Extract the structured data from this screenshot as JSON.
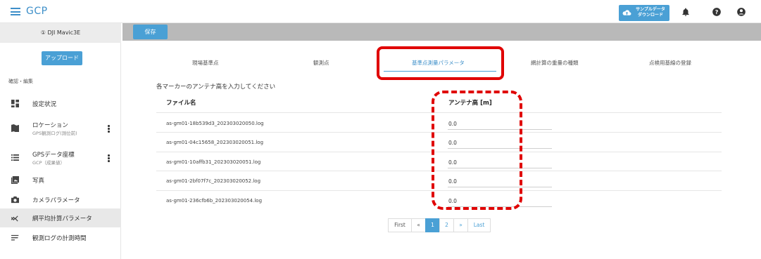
{
  "app": {
    "title": "GCP"
  },
  "header": {
    "sample_button_label_line1": "サンプルデータ",
    "sample_button_label_line2": "ダウンロード"
  },
  "sidebar": {
    "device": "① DJI Mavic3E",
    "upload_label": "アップロード",
    "section_label": "確認・編集",
    "items": [
      {
        "label": "設定状況",
        "sub": ""
      },
      {
        "label": "ロケーション",
        "sub": "GPS観測ログ(測位前)"
      },
      {
        "label": "GPSデータ座標",
        "sub": "GCP（成果値）"
      },
      {
        "label": "写真",
        "sub": ""
      },
      {
        "label": "カメラパラメータ",
        "sub": ""
      },
      {
        "label": "網平均計算パラメータ",
        "sub": ""
      },
      {
        "label": "観測ログの計測時間",
        "sub": ""
      }
    ]
  },
  "toolbar": {
    "save_label": "保存"
  },
  "tabs": [
    "現場基準点",
    "観測点",
    "基準点測量パラメータ",
    "網計算の重量の種類",
    "点検用基線の登録"
  ],
  "main": {
    "instruction": "各マーカーのアンテナ高を入力してください",
    "columns": [
      "ファイル名",
      "アンテナ高 [m]"
    ],
    "rows": [
      {
        "file": "as-gm01-18b539d3_202303020050.log",
        "height": "0.0"
      },
      {
        "file": "as-gm01-04c15658_202303020051.log",
        "height": "0.0"
      },
      {
        "file": "as-gm01-10affb31_202303020051.log",
        "height": "0.0"
      },
      {
        "file": "as-gm01-2bf07f7c_202303020052.log",
        "height": "0.0"
      },
      {
        "file": "as-gm01-236cfb6b_202303020054.log",
        "height": "0.0"
      }
    ]
  },
  "pagination": {
    "first": "First",
    "prev": "«",
    "pages": [
      "1",
      "2"
    ],
    "next": "»",
    "last": "Last"
  },
  "colors": {
    "accent": "#4aa0d5",
    "highlight": "#e00000"
  }
}
